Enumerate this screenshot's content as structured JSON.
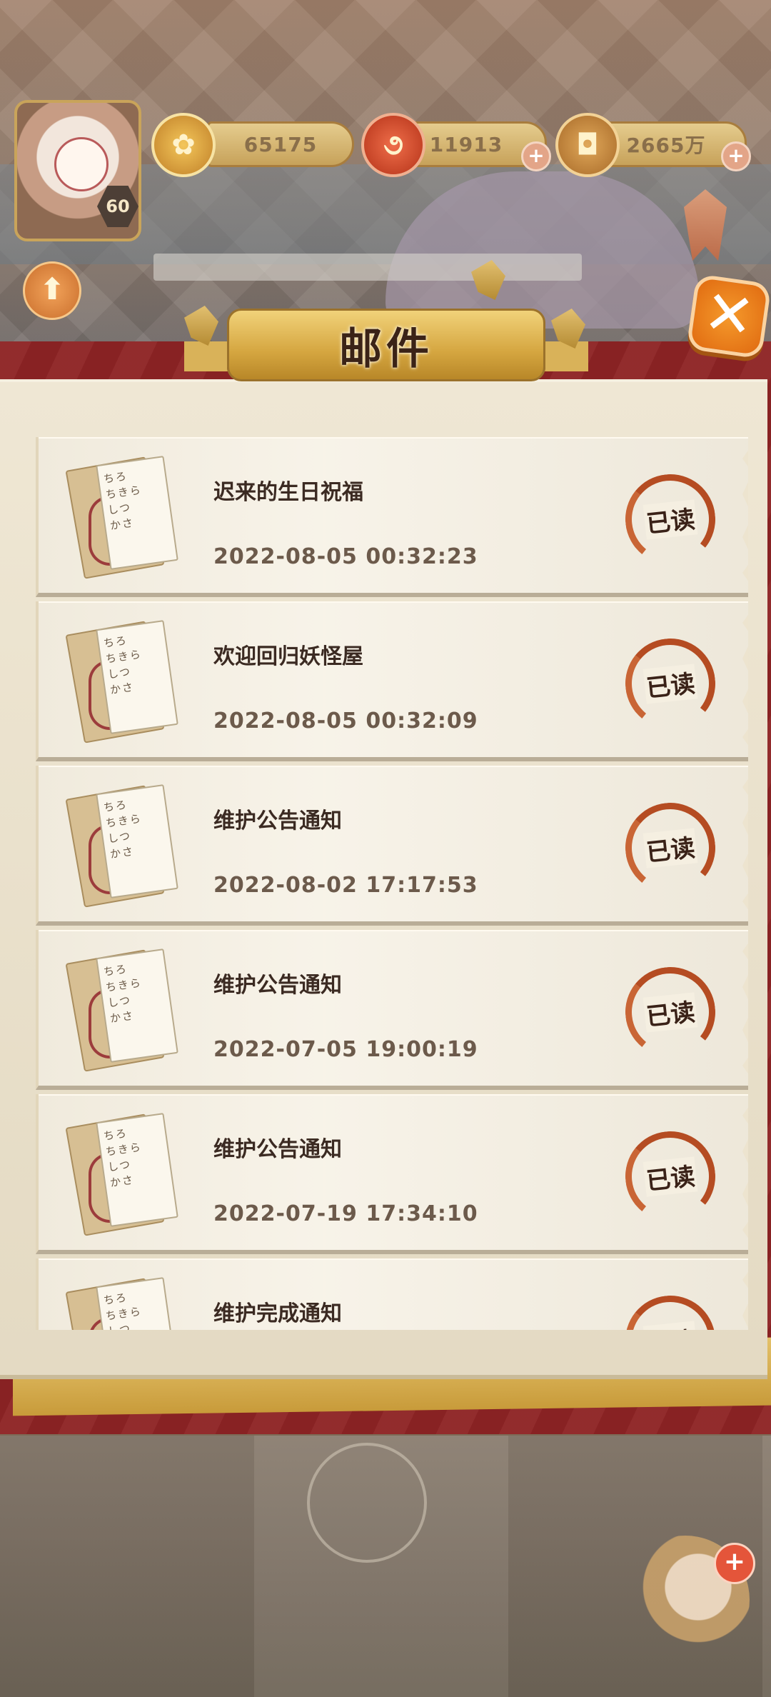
{
  "header": {
    "level": "60",
    "currencies": [
      {
        "name": "gold",
        "value": "65175"
      },
      {
        "name": "jade",
        "value": "11913"
      },
      {
        "name": "coin",
        "value": "2665万"
      }
    ]
  },
  "panel": {
    "title": "邮件"
  },
  "mails": [
    {
      "title": "迟来的生日祝福",
      "date": "2022-08-05 00:32:23",
      "status": "已读"
    },
    {
      "title": "欢迎回归妖怪屋",
      "date": "2022-08-05 00:32:09",
      "status": "已读"
    },
    {
      "title": "维护公告通知",
      "date": "2022-08-02 17:17:53",
      "status": "已读"
    },
    {
      "title": "维护公告通知",
      "date": "2022-07-05 19:00:19",
      "status": "已读"
    },
    {
      "title": "维护公告通知",
      "date": "2022-07-19 17:34:10",
      "status": "已读"
    },
    {
      "title": "维护完成通知",
      "date": "",
      "status": "已读"
    }
  ],
  "icons": {
    "gold": "chrysanthemum-coin-icon",
    "jade": "magatama-icon",
    "coin": "square-hole-coin-icon",
    "close": "close-icon",
    "upgrade": "up-arrow-icon",
    "mail": "letter-envelope-icon"
  },
  "colors": {
    "panel_red": "#8e2324",
    "stamp": "#b54c22",
    "gold": "#d5a640"
  }
}
